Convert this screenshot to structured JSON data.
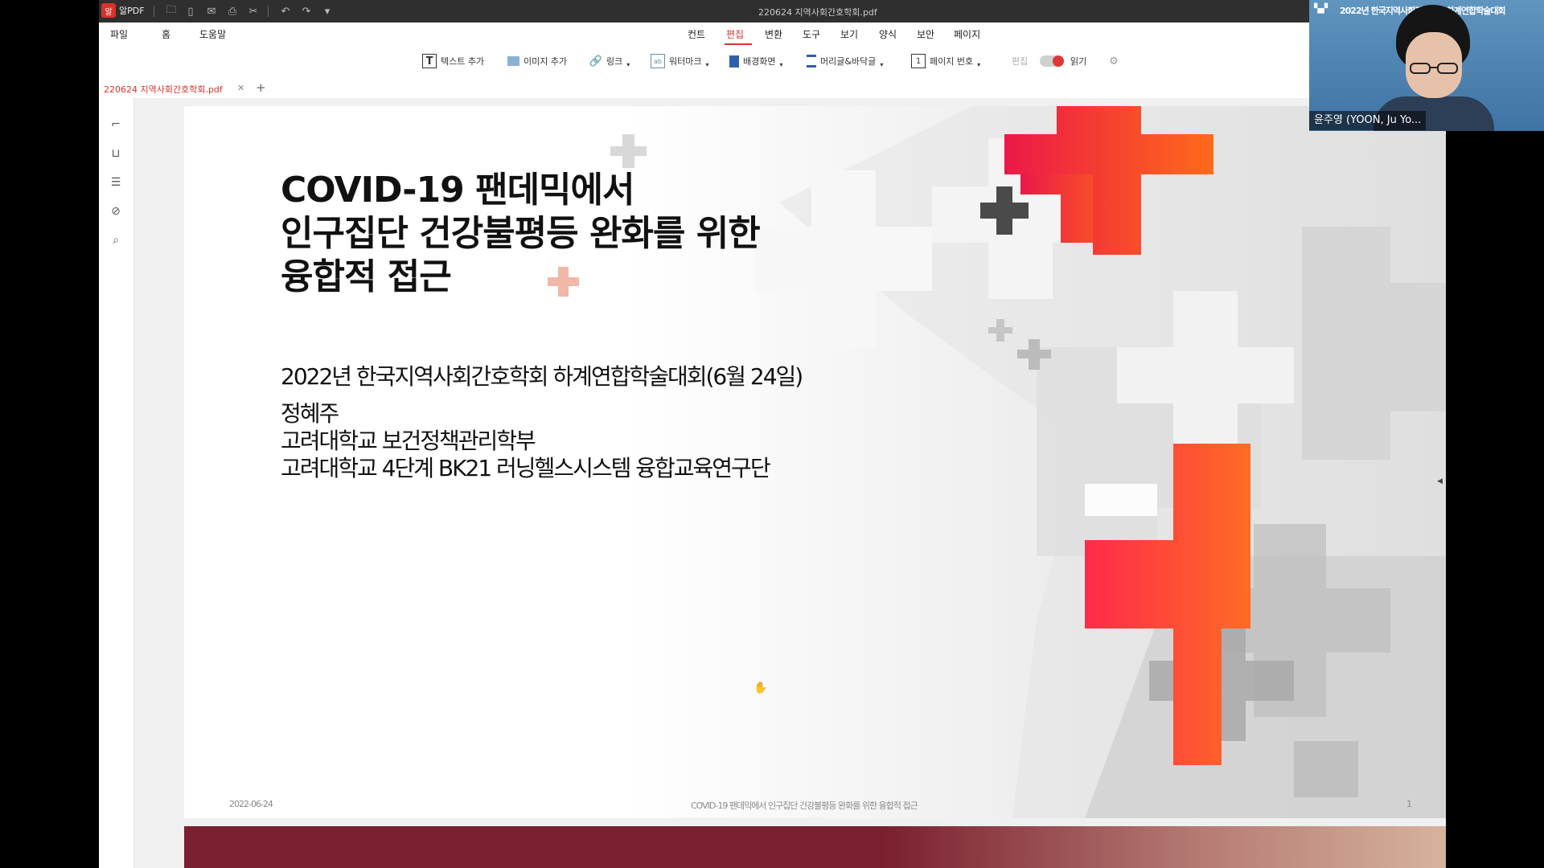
{
  "window": {
    "app_name": "알PDF",
    "title": "220624 지역사회간호학회.pdf"
  },
  "menu": {
    "left": [
      "파일",
      "홈",
      "도움말"
    ],
    "ribbon_tabs": [
      "컨트",
      "편집",
      "변환",
      "도구",
      "보기",
      "양식",
      "보안",
      "페이지"
    ],
    "active_tab": "편집"
  },
  "toolbar": {
    "add_text": "텍스트 추가",
    "add_image": "이미지 추가",
    "link": "링크",
    "watermark": "워터마크",
    "background": "배경화면",
    "header_footer": "머리글&바닥글",
    "page_number": "페이지 번호",
    "edit_label": "편집",
    "read_label": "읽기",
    "read_mode_on": true
  },
  "tabs": [
    {
      "label": "220624 지역사회간호학회.pdf"
    }
  ],
  "slide": {
    "title_line1": "COVID-19 팬데믹에서",
    "title_line2": "인구집단 건강불평등 완화를 위한",
    "title_line3": "융합적 접근",
    "conference": "2022년 한국지역사회간호학회 하계연합학술대회(6월 24일)",
    "presenter": "정혜주",
    "affiliation1": "고려대학교 보건정책관리학부",
    "affiliation2": "고려대학교 4단계 BK21 러닝헬스시스템 융합교육연구단",
    "footer_date": "2022-06-24",
    "footer_title": "COVID-19 팬데믹에서 인구집단 건강불평등 완화를 위한 융합적 접근",
    "page_number": "1"
  },
  "video": {
    "banner": "2022년 한국지역사회간호학회 하계연합학술대회",
    "participant_name": "윤주영 (YOON, Ju Yo..."
  },
  "colors": {
    "accent": "#d9322b",
    "titlebar": "#2f2f2f",
    "cross_red": "#f0452e",
    "next_slide": "#7a1f2f"
  }
}
